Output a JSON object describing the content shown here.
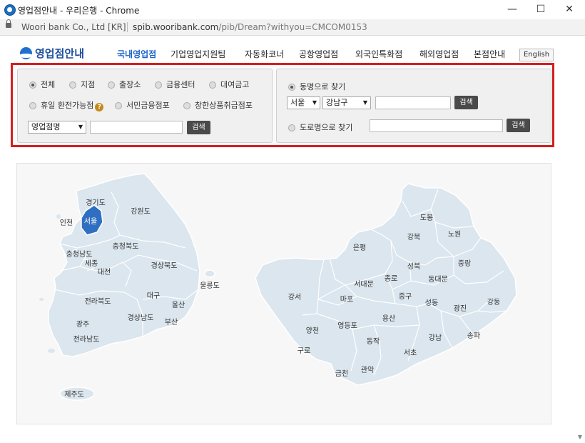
{
  "window": {
    "title": "영업점안내 - 우리은행 - Chrome",
    "site_label": "Woori bank Co., Ltd [KR]",
    "url_host": "spib.wooribank.com",
    "url_path": "/pib/Dream?withyou=CMCOM0153",
    "minimize": "—",
    "maximize": "☐",
    "close": "✕"
  },
  "header": {
    "logo": "영업점안내",
    "menu": [
      "국내영업점",
      "기업영업지원팀",
      "자동화코너",
      "공항영업점",
      "외국인특화점",
      "해외영업점",
      "본점안내"
    ],
    "lang": "English"
  },
  "search": {
    "branch_types": [
      "전체",
      "지점",
      "출장소",
      "금융센터",
      "대여금고"
    ],
    "branch_types_row2": [
      "휴일 환전가능점",
      "서민금융점포",
      "창한상품취급점포"
    ],
    "help": "?",
    "name_select": "영업점명",
    "search_btn": "검색",
    "dong_radio": "동명으로 찾기",
    "city_select": "서울",
    "district_select": "강남구",
    "road_radio": "도로명으로 찾기"
  },
  "map": {
    "korea_regions": [
      "경기도",
      "인천",
      "서울",
      "강원도",
      "충청북도",
      "충청남도",
      "세종",
      "대전",
      "경상북도",
      "전라북도",
      "대구",
      "울산",
      "광주",
      "경상남도",
      "부산",
      "전라남도",
      "제주도",
      "울릉도"
    ],
    "seoul_districts": [
      "도봉",
      "노원",
      "강북",
      "은평",
      "성북",
      "중랑",
      "종로",
      "동대문",
      "서대문",
      "중구",
      "강서",
      "마포",
      "성동",
      "광진",
      "강동",
      "용산",
      "양천",
      "영등포",
      "동작",
      "강남",
      "송파",
      "구로",
      "서초",
      "금천",
      "관악"
    ],
    "colors": {
      "region_fill": "#dbe6ee",
      "region_stroke": "#ffffff",
      "selected_fill": "#2f6fc2",
      "highlight_border": "#d51e1e"
    }
  }
}
